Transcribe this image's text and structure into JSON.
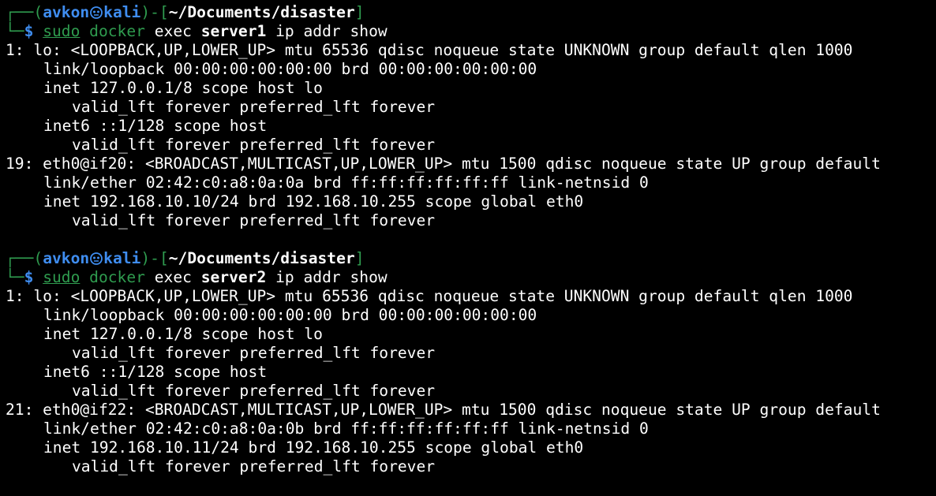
{
  "colors": {
    "background": "#000000",
    "text": "#ffffff",
    "prompt_frame": "#2f9c4f",
    "prompt_user": "#3f8df0"
  },
  "blocks": [
    {
      "prompt": {
        "frame_left": "┌──(",
        "user": "avkon",
        "at_icon": "kali-skull-icon",
        "host": "kali",
        "frame_mid": ")-[",
        "path": "~/Documents/disaster",
        "frame_right": "]",
        "frame_bottom": "└─",
        "dollar": "$"
      },
      "command": {
        "sudo": "sudo",
        "docker": "docker",
        "exec": "exec",
        "container": "server1",
        "rest": "ip addr show"
      },
      "output": [
        "1: lo: <LOOPBACK,UP,LOWER_UP> mtu 65536 qdisc noqueue state UNKNOWN group default qlen 1000",
        "link/loopback 00:00:00:00:00:00 brd 00:00:00:00:00:00",
        "inet 127.0.0.1/8 scope host lo",
        "valid_lft forever preferred_lft forever",
        "inet6 ::1/128 scope host",
        "valid_lft forever preferred_lft forever",
        "19: eth0@if20: <BROADCAST,MULTICAST,UP,LOWER_UP> mtu 1500 qdisc noqueue state UP group default",
        "link/ether 02:42:c0:a8:0a:0a brd ff:ff:ff:ff:ff:ff link-netnsid 0",
        "inet 192.168.10.10/24 brd 192.168.10.255 scope global eth0",
        "valid_lft forever preferred_lft forever"
      ]
    },
    {
      "prompt": {
        "frame_left": "┌──(",
        "user": "avkon",
        "at_icon": "kali-skull-icon",
        "host": "kali",
        "frame_mid": ")-[",
        "path": "~/Documents/disaster",
        "frame_right": "]",
        "frame_bottom": "└─",
        "dollar": "$"
      },
      "command": {
        "sudo": "sudo",
        "docker": "docker",
        "exec": "exec",
        "container": "server2",
        "rest": "ip addr show"
      },
      "output": [
        "1: lo: <LOOPBACK,UP,LOWER_UP> mtu 65536 qdisc noqueue state UNKNOWN group default qlen 1000",
        "link/loopback 00:00:00:00:00:00 brd 00:00:00:00:00:00",
        "inet 127.0.0.1/8 scope host lo",
        "valid_lft forever preferred_lft forever",
        "inet6 ::1/128 scope host",
        "valid_lft forever preferred_lft forever",
        "21: eth0@if22: <BROADCAST,MULTICAST,UP,LOWER_UP> mtu 1500 qdisc noqueue state UP group default",
        "link/ether 02:42:c0:a8:0a:0b brd ff:ff:ff:ff:ff:ff link-netnsid 0",
        "inet 192.168.10.11/24 brd 192.168.10.255 scope global eth0",
        "valid_lft forever preferred_lft forever"
      ]
    }
  ]
}
